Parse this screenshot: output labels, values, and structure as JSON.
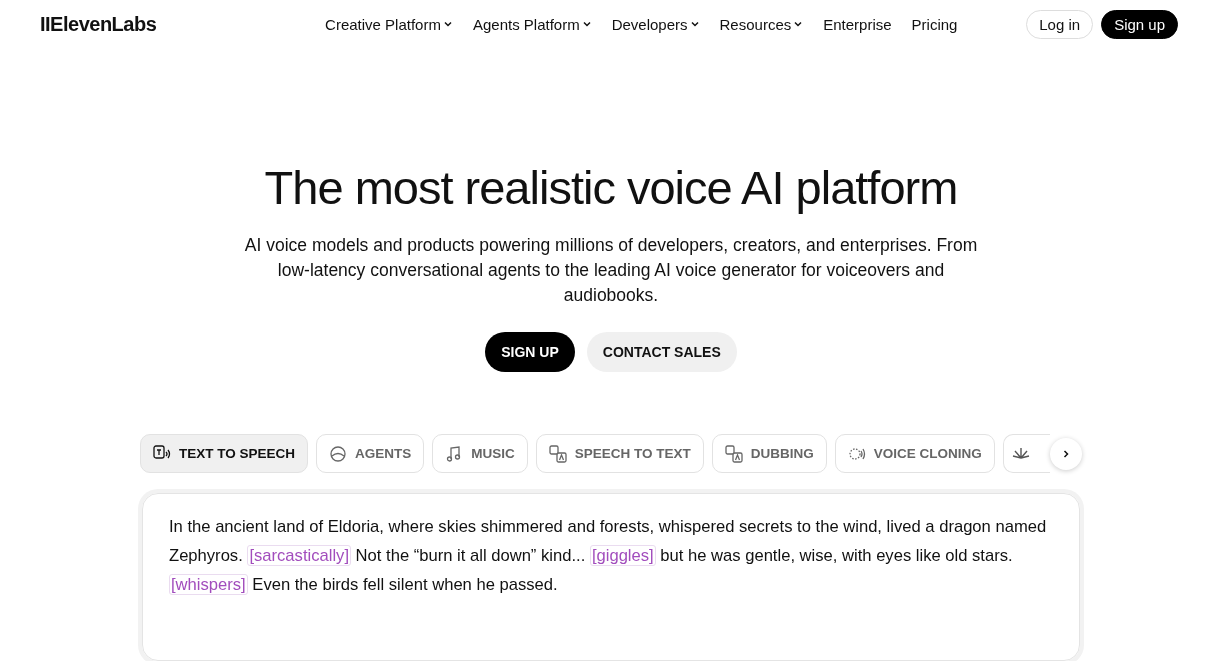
{
  "nav": {
    "logo": "IIElevenLabs",
    "links": [
      {
        "label": "Creative Platform",
        "dropdown": true
      },
      {
        "label": "Agents Platform",
        "dropdown": true
      },
      {
        "label": "Developers",
        "dropdown": true
      },
      {
        "label": "Resources",
        "dropdown": true
      },
      {
        "label": "Enterprise",
        "dropdown": false
      },
      {
        "label": "Pricing",
        "dropdown": false
      }
    ],
    "login": "Log in",
    "signup": "Sign up"
  },
  "hero": {
    "title": "The most realistic voice AI platform",
    "subtitle": "AI voice models and products powering millions of developers, creators, and enterprises. From low-latency conversational agents to the leading AI voice generator for voiceovers and audiobooks.",
    "primary": "SIGN UP",
    "secondary": "CONTACT SALES"
  },
  "tabs": [
    {
      "label": "TEXT TO SPEECH",
      "kind": "tts",
      "selected": true
    },
    {
      "label": "AGENTS",
      "kind": "agents",
      "selected": false
    },
    {
      "label": "MUSIC",
      "kind": "music",
      "selected": false
    },
    {
      "label": "SPEECH TO TEXT",
      "kind": "stt",
      "selected": false
    },
    {
      "label": "DUBBING",
      "kind": "dubbing",
      "selected": false
    },
    {
      "label": "VOICE CLONING",
      "kind": "cloning",
      "selected": false
    }
  ],
  "sample": [
    {
      "kind": "text",
      "text": "In the ancient land of Eldoria, where skies shimmered and forests, whispered secrets to the wind, lived a dragon named Zephyros. "
    },
    {
      "kind": "tag",
      "text": "[sarcastically]"
    },
    {
      "kind": "text",
      "text": " Not the “burn it all down” kind... "
    },
    {
      "kind": "tag",
      "text": "[giggles]"
    },
    {
      "kind": "text",
      "text": " but he was gentle, wise, with eyes like old stars. "
    },
    {
      "kind": "tag",
      "text": "[whispers]"
    },
    {
      "kind": "text",
      "text": " Even the birds fell silent when he passed."
    }
  ]
}
